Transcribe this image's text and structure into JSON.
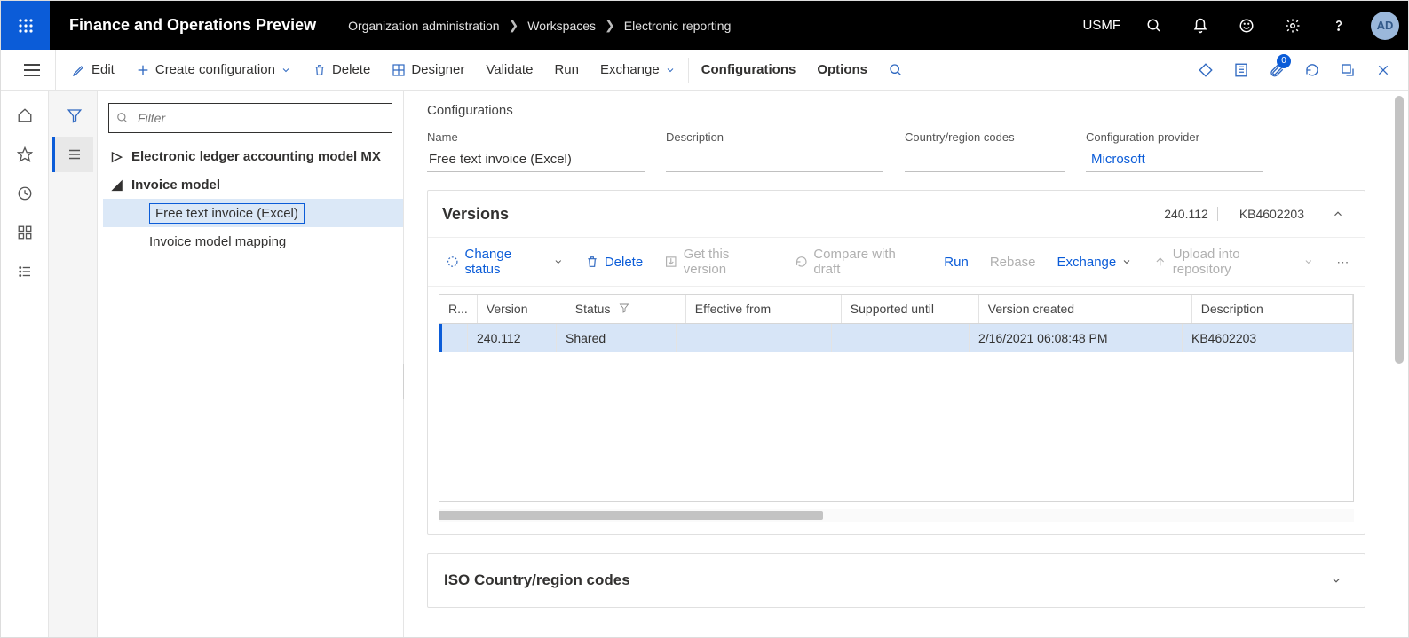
{
  "app": {
    "title": "Finance and Operations Preview"
  },
  "breadcrumb": {
    "items": [
      "Organization administration",
      "Workspaces",
      "Electronic reporting"
    ]
  },
  "company": "USMF",
  "avatar": "AD",
  "actionpane": {
    "edit": "Edit",
    "create": "Create configuration",
    "delete": "Delete",
    "designer": "Designer",
    "validate": "Validate",
    "run": "Run",
    "exchange": "Exchange",
    "configurations": "Configurations",
    "options": "Options",
    "attach_badge": "0"
  },
  "filter": {
    "placeholder": "Filter"
  },
  "tree": {
    "nodes": [
      {
        "label": "Electronic ledger accounting model MX",
        "bold": true,
        "expanded": false
      },
      {
        "label": "Invoice model",
        "bold": true,
        "expanded": true,
        "children": [
          {
            "label": "Free text invoice (Excel)",
            "selected": true
          },
          {
            "label": "Invoice model mapping",
            "selected": false
          }
        ]
      }
    ]
  },
  "detail": {
    "title_small": "Configurations",
    "fields": {
      "name_label": "Name",
      "name_value": "Free text invoice (Excel)",
      "description_label": "Description",
      "description_value": "",
      "codes_label": "Country/region codes",
      "codes_value": "",
      "provider_label": "Configuration provider",
      "provider_value": "Microsoft"
    }
  },
  "versions": {
    "title": "Versions",
    "summary_version": "240.112",
    "summary_desc": "KB4602203",
    "toolbar": {
      "change_status": "Change status",
      "delete": "Delete",
      "get_version": "Get this version",
      "compare": "Compare with draft",
      "run": "Run",
      "rebase": "Rebase",
      "exchange": "Exchange",
      "upload": "Upload into repository"
    },
    "columns": {
      "r": "R...",
      "version": "Version",
      "status": "Status",
      "effective_from": "Effective from",
      "supported_until": "Supported until",
      "created": "Version created",
      "description": "Description"
    },
    "rows": [
      {
        "r": "",
        "version": "240.112",
        "status": "Shared",
        "effective_from": "",
        "supported_until": "",
        "created": "2/16/2021 06:08:48 PM",
        "description": "KB4602203"
      }
    ]
  },
  "iso": {
    "title": "ISO Country/region codes"
  }
}
